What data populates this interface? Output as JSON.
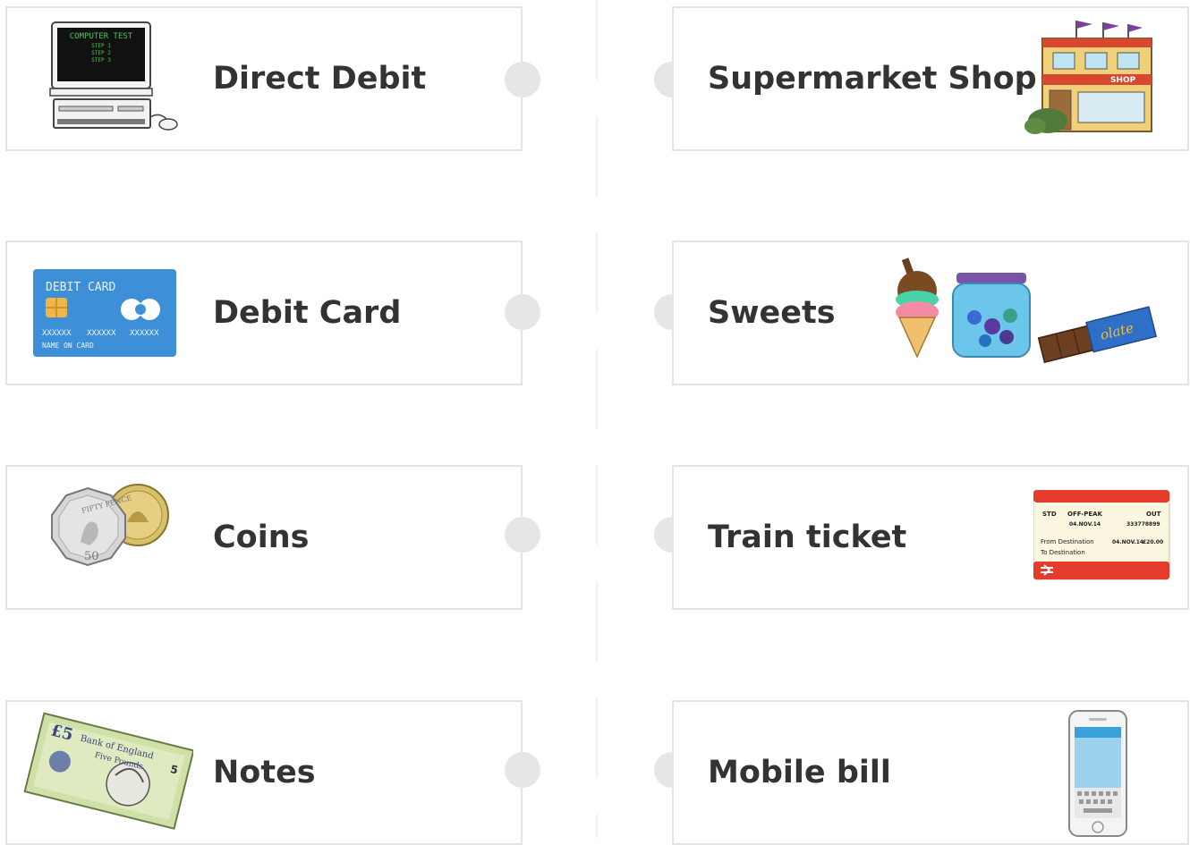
{
  "left_items": [
    {
      "label": "Direct Debit",
      "icon": "computer-icon"
    },
    {
      "label": "Debit Card",
      "icon": "debit-card-icon"
    },
    {
      "label": "Coins",
      "icon": "coins-icon"
    },
    {
      "label": "Notes",
      "icon": "banknote-icon"
    }
  ],
  "right_items": [
    {
      "label": "Supermarket Shop",
      "icon": "shop-icon"
    },
    {
      "label": "Sweets",
      "icon": "sweets-icon"
    },
    {
      "label": "Train ticket",
      "icon": "train-ticket-icon"
    },
    {
      "label": "Mobile bill",
      "icon": "mobile-phone-icon"
    }
  ],
  "computer_screen": {
    "line1": "COMPUTER TEST",
    "line2": "STEP 1",
    "line3": "STEP 2",
    "line4": "STEP 3"
  },
  "debit_card": {
    "title": "DEBIT CARD",
    "number1": "XXXXXX",
    "number2": "XXXXXX",
    "number3": "XXXXXX",
    "name": "NAME ON CARD"
  },
  "coin": {
    "text": "FIFTY PENCE",
    "value": "50"
  },
  "banknote": {
    "value": "£5",
    "bank": "Bank of England",
    "pounds": "Five Pounds",
    "corner": "5"
  },
  "shop": {
    "sign": "SHOP"
  },
  "sweets": {
    "wrapper": "olate"
  },
  "ticket": {
    "class": "STD",
    "type": "OFF-PEAK",
    "dir": "OUT",
    "date": "04.NOV.14",
    "number": "333778899",
    "from": "From Destination",
    "date2": "04.NOV.14",
    "price": "£20.00",
    "to": "To Destination"
  },
  "colors": {
    "card_border": "#e4e4e4",
    "knob": "#e6e6e6",
    "label": "#333333",
    "card_blue": "#3d8fd8",
    "ticket_red": "#e43b2c"
  }
}
